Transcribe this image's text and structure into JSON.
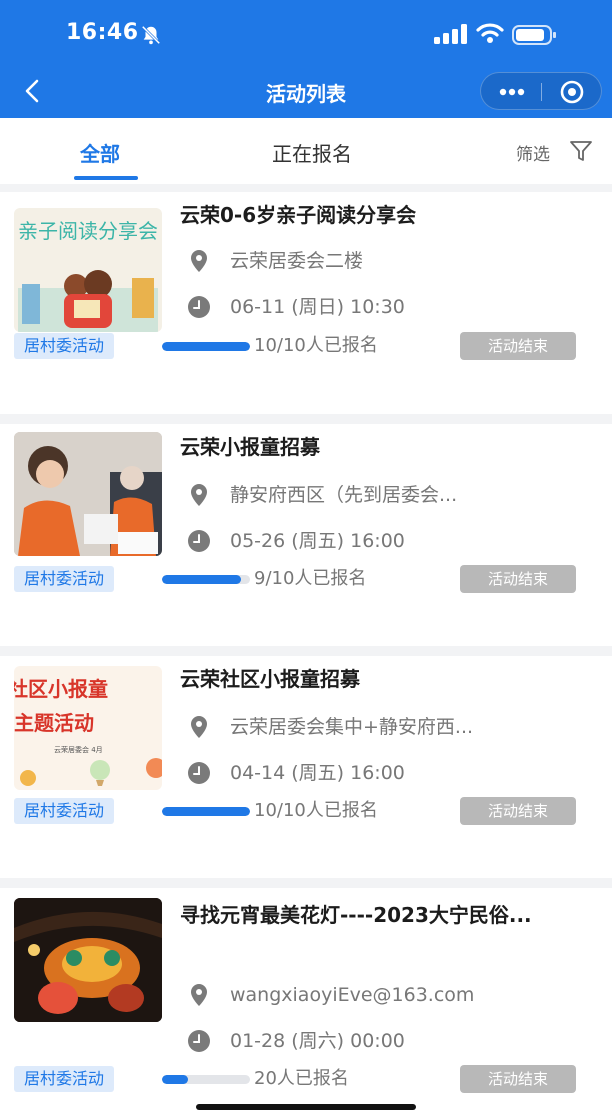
{
  "status_bar": {
    "time": "16:46"
  },
  "nav": {
    "title": "活动列表"
  },
  "tabs": [
    {
      "label": "全部"
    },
    {
      "label": "正在报名"
    }
  ],
  "filter": {
    "label": "筛选"
  },
  "activities": [
    {
      "title": "云荣0-6岁亲子阅读分享会",
      "location": "云荣居委会二楼",
      "datetime": "06-11 (周日) 10:30",
      "tag": "居村委活动",
      "registered_text": "10/10人已报名",
      "progress": 1.0,
      "status": "活动结束",
      "thumb_title": "亲子阅读分享会"
    },
    {
      "title": "云荣小报童招募",
      "location": "静安府西区（先到居委会...",
      "datetime": "05-26 (周五) 16:00",
      "tag": "居村委活动",
      "registered_text": "9/10人已报名",
      "progress": 0.9,
      "status": "活动结束"
    },
    {
      "title": "云荣社区小报童招募",
      "location": "云荣居委会集中+静安府西...",
      "datetime": "04-14 (周五) 16:00",
      "tag": "居村委活动",
      "registered_text": "10/10人已报名",
      "progress": 1.0,
      "status": "活动结束",
      "thumb_line1": "社区小报童",
      "thumb_line2": "主题活动",
      "thumb_small": "云荣居委会  4月"
    },
    {
      "title": " 寻找元宵最美花灯----2023大宁民俗...",
      "location": "wangxiaoyiEve@163.com",
      "datetime": "01-28 (周六) 00:00",
      "tag": "居村委活动",
      "registered_text": "20人已报名",
      "progress": 0.3,
      "status": "活动结束"
    }
  ],
  "colors": {
    "primary": "#1f78e6",
    "tag_bg": "#ddeafb",
    "status_bg": "#b8b8b8"
  },
  "icons": [
    "bell-mute-icon",
    "signal-icon",
    "wifi-icon",
    "battery-icon",
    "back-icon",
    "more-icon",
    "close-target-icon",
    "filter-icon",
    "location-pin-icon",
    "clock-icon"
  ]
}
